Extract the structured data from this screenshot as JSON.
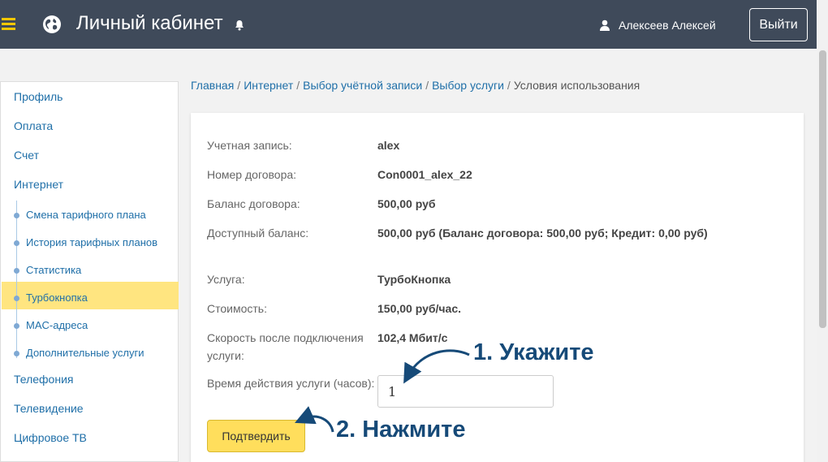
{
  "header": {
    "title": "Личный кабинет",
    "user_name": "Алексеев Алексей",
    "logout_label": "Выйти"
  },
  "sidebar": {
    "items": [
      {
        "label": "Профиль"
      },
      {
        "label": "Оплата"
      },
      {
        "label": "Счет"
      },
      {
        "label": "Интернет"
      },
      {
        "label": "Телефония"
      },
      {
        "label": "Телевидение"
      },
      {
        "label": "Цифровое ТВ"
      }
    ],
    "subitems": [
      {
        "label": "Смена тарифного плана"
      },
      {
        "label": "История тарифных планов"
      },
      {
        "label": "Статистика"
      },
      {
        "label": "Турбокнопка",
        "active": true
      },
      {
        "label": "MAC-адреса"
      },
      {
        "label": "Дополнительные услуги"
      }
    ]
  },
  "breadcrumb": {
    "items": [
      "Главная",
      "Интернет",
      "Выбор учётной записи",
      "Выбор услуги"
    ],
    "current": "Условия использования",
    "separator": "/"
  },
  "details": {
    "rows": [
      {
        "label": "Учетная запись:",
        "value": "alex"
      },
      {
        "label": "Номер договора:",
        "value": "Con0001_alex_22"
      },
      {
        "label": "Баланс договора:",
        "value": "500,00  руб"
      },
      {
        "label": "Доступный баланс:",
        "value": "500,00  руб (Баланс договора: 500,00  руб; Кредит: 0,00 руб)"
      },
      {
        "label": "Услуга:",
        "value": "ТурбоКнопка"
      },
      {
        "label": "Стоимость:",
        "value": "150,00  руб/час."
      },
      {
        "label": "Скорость после подключения услуги:",
        "value": "102,4 Мбит/с"
      }
    ],
    "hours_label": "Время действия услуги (часов):",
    "hours_value": "1",
    "confirm_label": "Подтвердить"
  },
  "annotations": {
    "step1": "1. Укажите",
    "step2": "2. Нажмите"
  },
  "colors": {
    "topbar": "#3f4a5a",
    "accent_yellow": "#ffde5c",
    "link_blue": "#1f6fa8",
    "annotation": "#164a78"
  }
}
